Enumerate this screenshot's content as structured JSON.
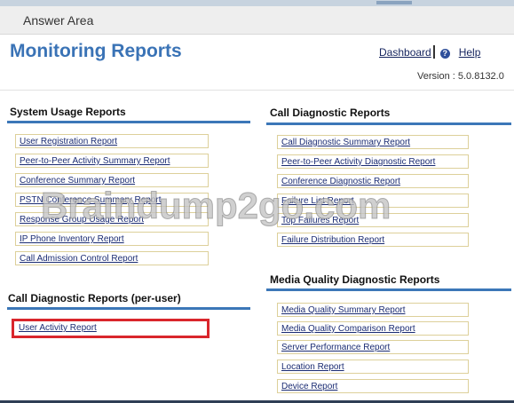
{
  "answer_area": "Answer Area",
  "page_title": "Monitoring Reports",
  "dashboard_link": "Dashboard",
  "help_link": "Help",
  "version": "Version : 5.0.8132.0",
  "sections": {
    "system_usage": {
      "title": "System Usage Reports",
      "items": [
        "User Registration Report",
        "Peer-to-Peer Activity Summary Report",
        "Conference Summary Report",
        "PSTN Conference Summary Report",
        "Response Group Usage Report",
        "IP Phone Inventory Report",
        "Call Admission Control Report"
      ]
    },
    "call_diag_user": {
      "title": "Call Diagnostic Reports (per-user)",
      "items": [
        "User Activity Report"
      ]
    },
    "call_diag": {
      "title": "Call Diagnostic Reports",
      "items": [
        "Call Diagnostic Summary Report",
        "Peer-to-Peer Activity Diagnostic Report",
        "Conference Diagnostic Report",
        "Failure List Report",
        "Top Failures Report",
        "Failure Distribution Report"
      ]
    },
    "media_quality": {
      "title": "Media Quality Diagnostic Reports",
      "items": [
        "Media Quality Summary Report",
        "Media Quality Comparison Report",
        "Server Performance Report",
        "Location Report",
        "Device Report"
      ]
    }
  },
  "watermark": "Braindump2go.com",
  "colors": {
    "title_blue": "#3a73b6",
    "link_navy": "#1b2c73",
    "box_border": "#ddd09a",
    "highlight_red": "#d9262c"
  }
}
